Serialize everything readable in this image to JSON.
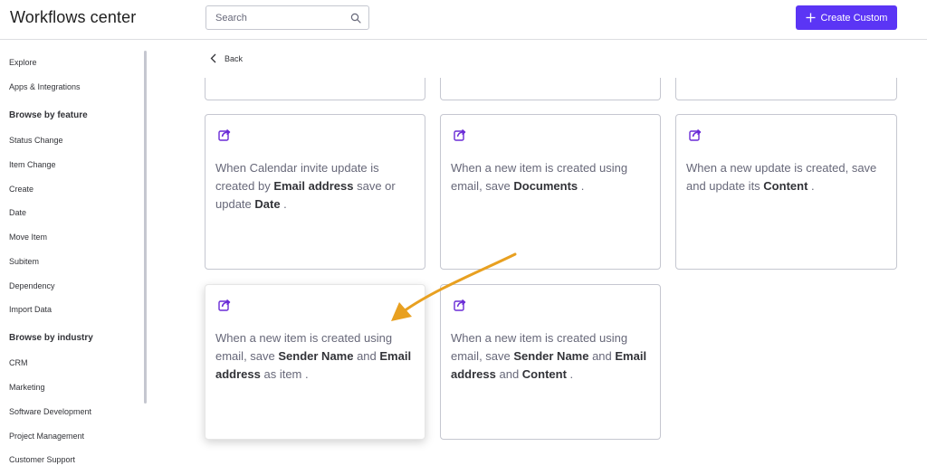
{
  "header": {
    "title": "Workflows center",
    "search_placeholder": "Search",
    "create_label": "Create Custom"
  },
  "sidebar": {
    "top_items": [
      "Explore",
      "Apps & Integrations"
    ],
    "feature_heading": "Browse by feature",
    "feature_items": [
      "Status Change",
      "Item Change",
      "Create",
      "Date",
      "Move Item",
      "Subitem",
      "Dependency",
      "Import Data"
    ],
    "industry_heading": "Browse by industry",
    "industry_items": [
      "CRM",
      "Marketing",
      "Software Development",
      "Project Management",
      "Customer Support"
    ]
  },
  "main": {
    "back_label": "Back",
    "cards": [
      {
        "parts": [
          {
            "t": "When Calendar invite update is created by ",
            "b": false
          },
          {
            "t": "Email address",
            "b": true
          },
          {
            "t": " save or update ",
            "b": false
          },
          {
            "t": "Date",
            "b": true
          },
          {
            "t": " .",
            "b": false
          }
        ]
      },
      {
        "parts": [
          {
            "t": "When a new item is created using email, save ",
            "b": false
          },
          {
            "t": "Documents",
            "b": true
          },
          {
            "t": " .",
            "b": false
          }
        ]
      },
      {
        "parts": [
          {
            "t": "When a new update is created, save and update its ",
            "b": false
          },
          {
            "t": "Content",
            "b": true
          },
          {
            "t": " .",
            "b": false
          }
        ]
      },
      {
        "parts": [
          {
            "t": "When a new item is created using email, save ",
            "b": false
          },
          {
            "t": "Sender Name",
            "b": true
          },
          {
            "t": " and ",
            "b": false
          },
          {
            "t": "Email address",
            "b": true
          },
          {
            "t": " as item .",
            "b": false
          }
        ]
      },
      {
        "parts": [
          {
            "t": "When a new item is created using email, save ",
            "b": false
          },
          {
            "t": "Sender Name",
            "b": true
          },
          {
            "t": " and ",
            "b": false
          },
          {
            "t": "Email address",
            "b": true
          },
          {
            "t": " and ",
            "b": false
          },
          {
            "t": "Content",
            "b": true
          },
          {
            "t": " .",
            "b": false
          }
        ]
      }
    ]
  },
  "colors": {
    "accent": "#5b35f5",
    "icon": "#6a2bd6",
    "annotation_arrow": "#e8a020"
  },
  "icons": {
    "search": "search-icon",
    "plus": "plus-icon",
    "back": "chevron-left-icon",
    "card": "share-arrow-icon"
  }
}
